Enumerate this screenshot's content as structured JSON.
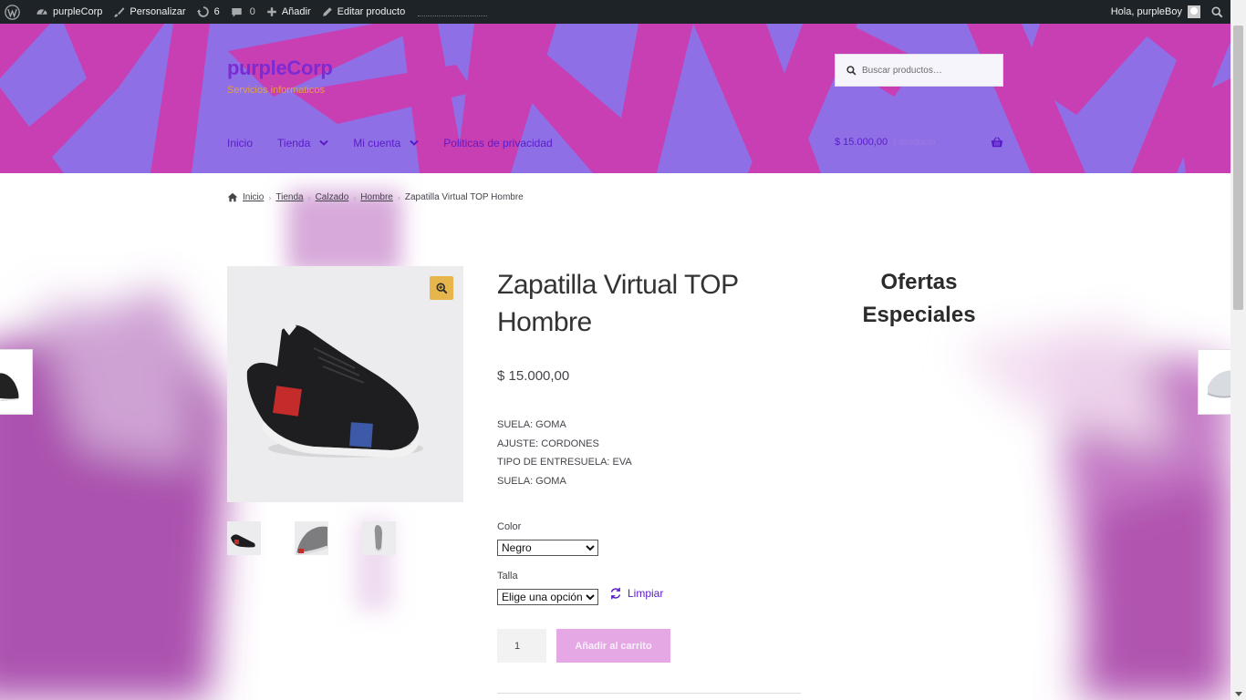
{
  "admin_bar": {
    "site_name": "purpleCorp",
    "customize_label": "Personalizar",
    "updates_count": "6",
    "comments_count": "0",
    "add_label": "Añadir",
    "edit_label": "Editar producto",
    "greeting": "Hola, purpleBoy"
  },
  "header": {
    "site_title": "purpleCorp",
    "site_description": "Servicios informaticos",
    "search_placeholder": "Buscar productos…",
    "nav": [
      {
        "label": "Inicio"
      },
      {
        "label": "Tienda"
      },
      {
        "label": "Mi cuenta"
      },
      {
        "label": "Politicas de privacidad"
      }
    ],
    "cart_amount": "$ 15.000,00",
    "cart_count": "1 producto"
  },
  "breadcrumb": {
    "items": [
      "Inicio",
      "Tienda",
      "Calzado",
      "Hombre"
    ],
    "current": "Zapatilla Virtual TOP Hombre"
  },
  "product": {
    "title": "Zapatilla Virtual TOP Hombre",
    "price": "$ 15.000,00",
    "specs": [
      "SUELA: GOMA",
      "AJUSTE: CORDONES",
      "TIPO DE ENTRESUELA: EVA",
      "SUELA: GOMA"
    ],
    "color_label": "Color",
    "color_selected": "Negro",
    "size_label": "Talla",
    "size_selected": "Elige una opción",
    "clear_label": "Limpiar",
    "quantity": "1",
    "add_to_cart_label": "Añadir al carrito"
  },
  "sidebar": {
    "widget_title": "Ofertas Especiales"
  },
  "colors": {
    "brand": "#7b2bd4",
    "header_purple": "#8f6fe6",
    "header_magenta": "#c83fb4",
    "tagline": "#e5a13b",
    "add_to_cart": "#e6a8e4",
    "zoom": "#e6b64c"
  },
  "icons": [
    "wordpress-icon",
    "dashboard-icon",
    "brush-icon",
    "updates-icon",
    "comments-icon",
    "plus-icon",
    "pencil-icon",
    "user-icon",
    "search-icon",
    "chevron-down-icon",
    "basket-icon",
    "home-icon",
    "zoom-in-icon",
    "refresh-icon"
  ]
}
